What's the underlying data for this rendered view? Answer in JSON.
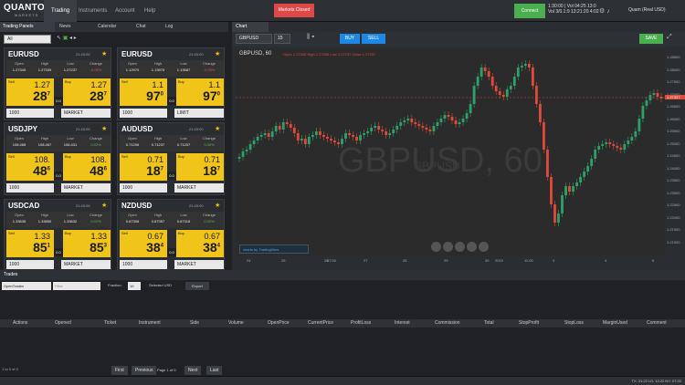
{
  "top": {
    "logo": "QUANTO",
    "logo_sub": "MARKETS",
    "nav": [
      "Trading",
      "Instruments",
      "Account",
      "Help"
    ],
    "market_status": "Markets Closed",
    "connect": "Connect",
    "time1": "1:30:00 | Vol 04:25 13:0",
    "time2": "Vol 3/0.1:9 13:21:20 4:02",
    "user": "Quam (Real USD)",
    "accent": "#4bae4f"
  },
  "left": {
    "tabs": [
      "Trading Panels",
      "News",
      "Calendar",
      "Chat",
      "Log"
    ],
    "filter": "All"
  },
  "cards": [
    {
      "symbol": "EURUSD",
      "time": "21:43:00",
      "open": "Open",
      "high": "High",
      "low": "Low",
      "change": "Change",
      "v_open": "1.27345",
      "v_high": "1.27339",
      "v_low": "1.27237",
      "v_change": "-0.05%",
      "sell_label": "Sell",
      "sell_big": "1.27",
      "sell_pip": "28",
      "sell_last": "7",
      "spread": "0.0",
      "buy_label": "Buy",
      "buy_big": "1.27",
      "buy_pip": "28",
      "buy_last": "7",
      "lot": "1000",
      "otype": "MARKET"
    },
    {
      "symbol": "EURUSD",
      "time": "21:43:00",
      "open": "Open",
      "high": "High",
      "low": "Low",
      "change": "Change",
      "v_open": "1.12970",
      "v_high": "1.13970",
      "v_low": "1.13587",
      "v_change": "-0.09%",
      "sell_label": "Sell",
      "sell_big": "1.1",
      "sell_pip": "97",
      "sell_last": "0",
      "spread": "0.0",
      "buy_label": "Buy",
      "buy_big": "1.1",
      "buy_pip": "97",
      "buy_last": "0",
      "lot": "1000",
      "otype": "LIMIT"
    },
    {
      "symbol": "USDJPY",
      "time": "21:43:00",
      "open": "Open",
      "high": "High",
      "low": "Low",
      "change": "Change",
      "v_open": "108.465",
      "v_high": "108.487",
      "v_low": "108.431",
      "v_change": "0.02%",
      "sell_label": "Sell",
      "sell_big": "108.",
      "sell_pip": "48",
      "sell_last": "6",
      "spread": "0.0",
      "buy_label": "Buy",
      "buy_big": "108.",
      "buy_pip": "48",
      "buy_last": "6",
      "lot": "1000",
      "otype": "MARKET"
    },
    {
      "symbol": "AUDUSD",
      "time": "21:43:00",
      "open": "Open",
      "high": "High",
      "low": "Low",
      "change": "Change",
      "v_open": "0.71206",
      "v_high": "0.71237",
      "v_low": "0.71207",
      "v_change": "0.00%",
      "sell_label": "Sell",
      "sell_big": "0.71",
      "sell_pip": "18",
      "sell_last": "7",
      "spread": "0.0",
      "buy_label": "Buy",
      "buy_big": "0.71",
      "buy_pip": "18",
      "buy_last": "7",
      "lot": "1000",
      "otype": "MARKET"
    },
    {
      "symbol": "USDCAD",
      "time": "21:43:00",
      "open": "Open",
      "high": "High",
      "low": "Low",
      "change": "Change",
      "v_open": "1.33635",
      "v_high": "1.33850",
      "v_low": "1.33632",
      "v_change": "0.02%",
      "sell_label": "Sell",
      "sell_big": "1.33",
      "sell_pip": "85",
      "sell_last": "1",
      "spread": "0.0",
      "buy_label": "Buy",
      "buy_big": "1.33",
      "buy_pip": "85",
      "buy_last": "3",
      "lot": "1000",
      "otype": "MARKET"
    },
    {
      "symbol": "NZDUSD",
      "time": "21:43:00",
      "open": "Open",
      "high": "High",
      "low": "Low",
      "change": "Change",
      "v_open": "0.67308",
      "v_high": "0.67357",
      "v_low": "0.67318",
      "v_change": "0.02%",
      "sell_label": "Sell",
      "sell_big": "0.67",
      "sell_pip": "38",
      "sell_last": "4",
      "spread": "0.0",
      "buy_label": "Buy",
      "buy_big": "0.67",
      "buy_pip": "38",
      "buy_last": "4",
      "lot": "1000",
      "otype": "MARKET"
    }
  ],
  "chart": {
    "tab": "Chart",
    "symbol": "GBPUSD",
    "tf": "15",
    "buy": "BUY",
    "sell": "SELL",
    "save": "SAVE",
    "legend": "GBPUSD, 60",
    "ohlc": "Open 1.27345 High 1.27345 Low 1.27237 Close 1.27337",
    "wm1": "GBPUSD, 60",
    "wm2": "GBPUSD",
    "credit": "charts by TradingView",
    "xticks": [
      "24",
      "25",
      "26",
      "07:00",
      "27",
      "28",
      "29",
      "30",
      "2019",
      "11:00",
      "3",
      "4",
      "5"
    ],
    "yticks": [
      "1.28500",
      "1.28000",
      "1.27500",
      "1.27000",
      "1.26500",
      "1.26000",
      "1.25500",
      "1.25000",
      "1.24500",
      "1.24000",
      "1.23500",
      "1.23000",
      "1.22500",
      "1.22000",
      "1.21500",
      "1.21000"
    ],
    "price_label": "1.27337",
    "up_color": "#2ea06a",
    "down_color": "#e04a3a",
    "bg": "#2b2b2b"
  },
  "trades": {
    "tab": "Trades",
    "type": "OpenTrades",
    "filter": "Filter",
    "fraction": "Fraction:",
    "fraction_val": "10",
    "selected": "Selected USD",
    "export": "Export",
    "cols": [
      "Actions",
      "Opened",
      "Ticket",
      "Instrument",
      "Side",
      "Volume",
      "OpenPrice",
      "CurrentPrice",
      "ProfitLoss",
      "Interest",
      "Commission",
      "Total",
      "StopProfit",
      "StopLoss",
      "MarginUsed",
      "Comment"
    ],
    "count": "1 to 0 of 0",
    "pages": [
      "First",
      "Previous",
      "Page 1 of 0",
      "Next",
      "Last"
    ]
  },
  "status": "TX: 21:22 LD: 12:22 NY: 07:22"
}
